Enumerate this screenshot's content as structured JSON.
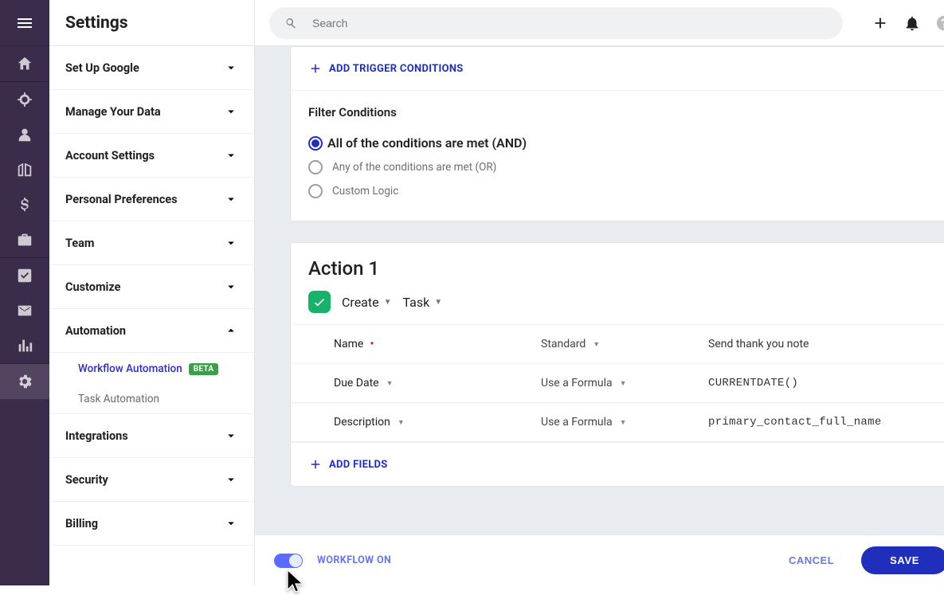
{
  "header": {
    "title": "Settings",
    "search_placeholder": "Search"
  },
  "sidebar": {
    "items": [
      {
        "label": "Set Up Google",
        "expanded": false
      },
      {
        "label": "Manage Your Data",
        "expanded": false
      },
      {
        "label": "Account Settings",
        "expanded": false
      },
      {
        "label": "Personal Preferences",
        "expanded": false
      },
      {
        "label": "Team",
        "expanded": false
      },
      {
        "label": "Customize",
        "expanded": false
      },
      {
        "label": "Automation",
        "expanded": true,
        "subitems": [
          {
            "label": "Workflow Automation",
            "badge": "BETA",
            "active": true
          },
          {
            "label": "Task Automation",
            "active": false
          }
        ]
      },
      {
        "label": "Integrations",
        "expanded": false
      },
      {
        "label": "Security",
        "expanded": false
      },
      {
        "label": "Billing",
        "expanded": false
      }
    ]
  },
  "trigger": {
    "add_trigger_label": "ADD TRIGGER CONDITIONS",
    "filter_heading": "Filter Conditions",
    "options": [
      {
        "label": "All of the conditions are met (AND)",
        "selected": true
      },
      {
        "label": "Any of the conditions are met (OR)",
        "selected": false
      },
      {
        "label": "Custom Logic",
        "selected": false
      }
    ]
  },
  "action": {
    "title": "Action 1",
    "verb": "Create",
    "object": "Task",
    "fields": [
      {
        "name": "Name",
        "required": true,
        "mode": "Standard",
        "value": "Send thank you note",
        "mono": false
      },
      {
        "name": "Due Date",
        "required": false,
        "mode": "Use a Formula",
        "value": "CURRENTDATE()",
        "mono": true
      },
      {
        "name": "Description",
        "required": false,
        "mode": "Use a Formula",
        "value": "primary_contact_full_name",
        "mono": true
      }
    ],
    "add_fields_label": "ADD FIELDS"
  },
  "footer": {
    "workflow_label": "WORKFLOW ON",
    "workflow_on": true,
    "cancel_label": "CANCEL",
    "save_label": "SAVE"
  }
}
